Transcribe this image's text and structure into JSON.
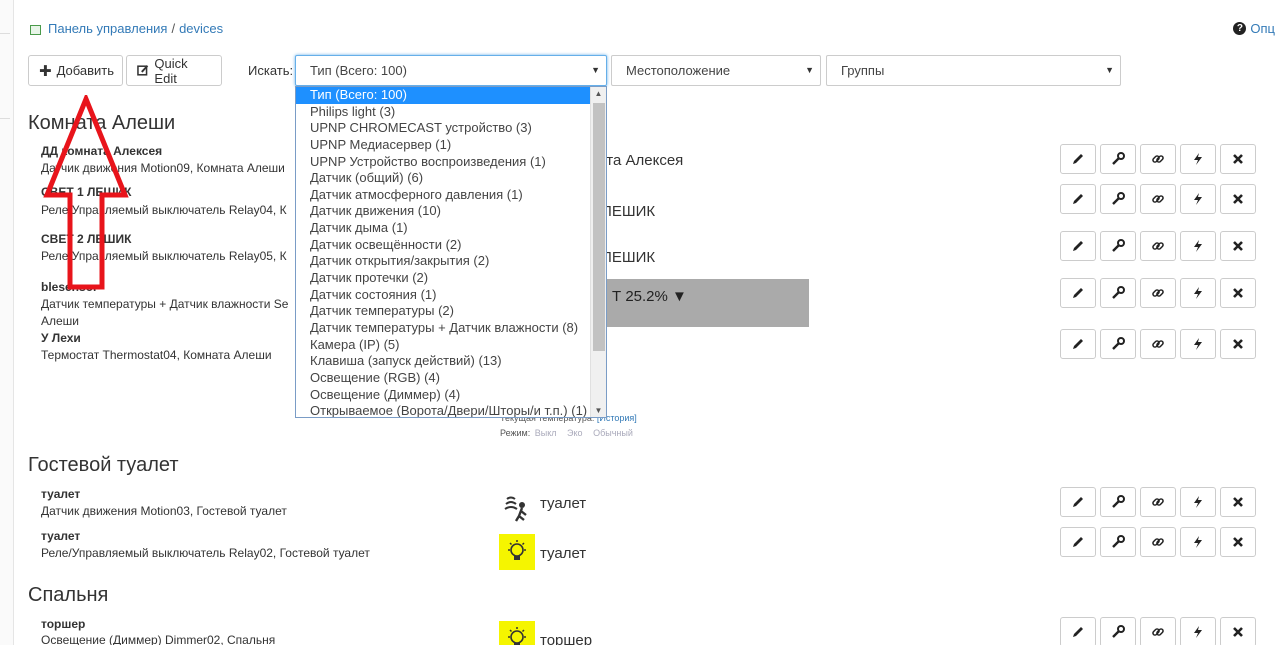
{
  "breadcrumb": {
    "root": "Панель управления",
    "separator": "/",
    "current": "devices"
  },
  "help_label": "Опц",
  "toolbar": {
    "add_label": "Добавить",
    "quick_edit_label": "Quick Edit",
    "search_label": "Искать:"
  },
  "filters": {
    "type_selected": "Тип (Всего: 100)",
    "location_selected": "Местоположение",
    "groups_selected": "Группы"
  },
  "type_dropdown_options": [
    "Тип (Всего: 100)",
    "Philips light (3)",
    "UPNP CHROMECAST устройство (3)",
    "UPNP Медиасервер (1)",
    "UPNP Устройство воспроизведения (1)",
    "Датчик (общий) (6)",
    "Датчик атмосферного давления (1)",
    "Датчик движения (10)",
    "Датчик дыма (1)",
    "Датчик освещённости (2)",
    "Датчик открытия/закрытия (2)",
    "Датчик протечки (2)",
    "Датчик состояния (1)",
    "Датчик температуры (2)",
    "Датчик температуры + Датчик влажности (8)",
    "Камера (IP) (5)",
    "Клавиша (запуск действий) (13)",
    "Освещение (RGB) (4)",
    "Освещение (Диммер) (4)",
    "Открываемое (Ворота/Двери/Шторы/и т.п.) (1)"
  ],
  "rooms": [
    {
      "title": "Комната Алеши",
      "devices": [
        {
          "name": "ДД комната Алексея",
          "desc": "Датчик движения Motion09, Комната Алеши",
          "status": "ната Алексея"
        },
        {
          "name": "СВЕТ 1 ЛЕШИК",
          "desc": "Реле/Управляемый выключатель Relay04, К",
          "status": "ЛЕШИК"
        },
        {
          "name": "СВЕТ 2 ЛЕШИК",
          "desc": "Реле/Управляемый выключатель Relay05, К",
          "status": "ЛЕШИК"
        },
        {
          "name": "blesensor",
          "desc": "Датчик температуры + Датчик влажности Se",
          "desc2": "Алеши",
          "status": "Т 25.2% ▼"
        },
        {
          "name": "У Лехи",
          "desc": "Термостат Thermostat04, Комната Алеши"
        }
      ],
      "thermostat": {
        "current_temp_label": "Текущая температура:",
        "history_link": "[История]",
        "mode_label": "Режим:",
        "modes": [
          "Выкл",
          "Эко",
          "Обычный"
        ]
      }
    },
    {
      "title": "Гостевой туалет",
      "devices": [
        {
          "name": "туалет",
          "desc": "Датчик движения Motion03, Гостевой туалет",
          "status": "туалет"
        },
        {
          "name": "туалет",
          "desc": "Реле/Управляемый выключатель Relay02, Гостевой туалет",
          "status": "туалет"
        }
      ]
    },
    {
      "title": "Спальня",
      "devices": [
        {
          "name": "торшер",
          "desc": "Освещение (Диммер) Dimmer02, Спальня",
          "status": "торшер"
        }
      ]
    }
  ],
  "row_actions": [
    "pencil-icon",
    "wrench-icon",
    "link-icon",
    "bolt-icon",
    "close-icon"
  ],
  "colors": {
    "link": "#337ab7",
    "selected_option": "#1e90ff",
    "annotation_arrow": "#e8141b",
    "light_icon_bg": "#f5f500"
  }
}
